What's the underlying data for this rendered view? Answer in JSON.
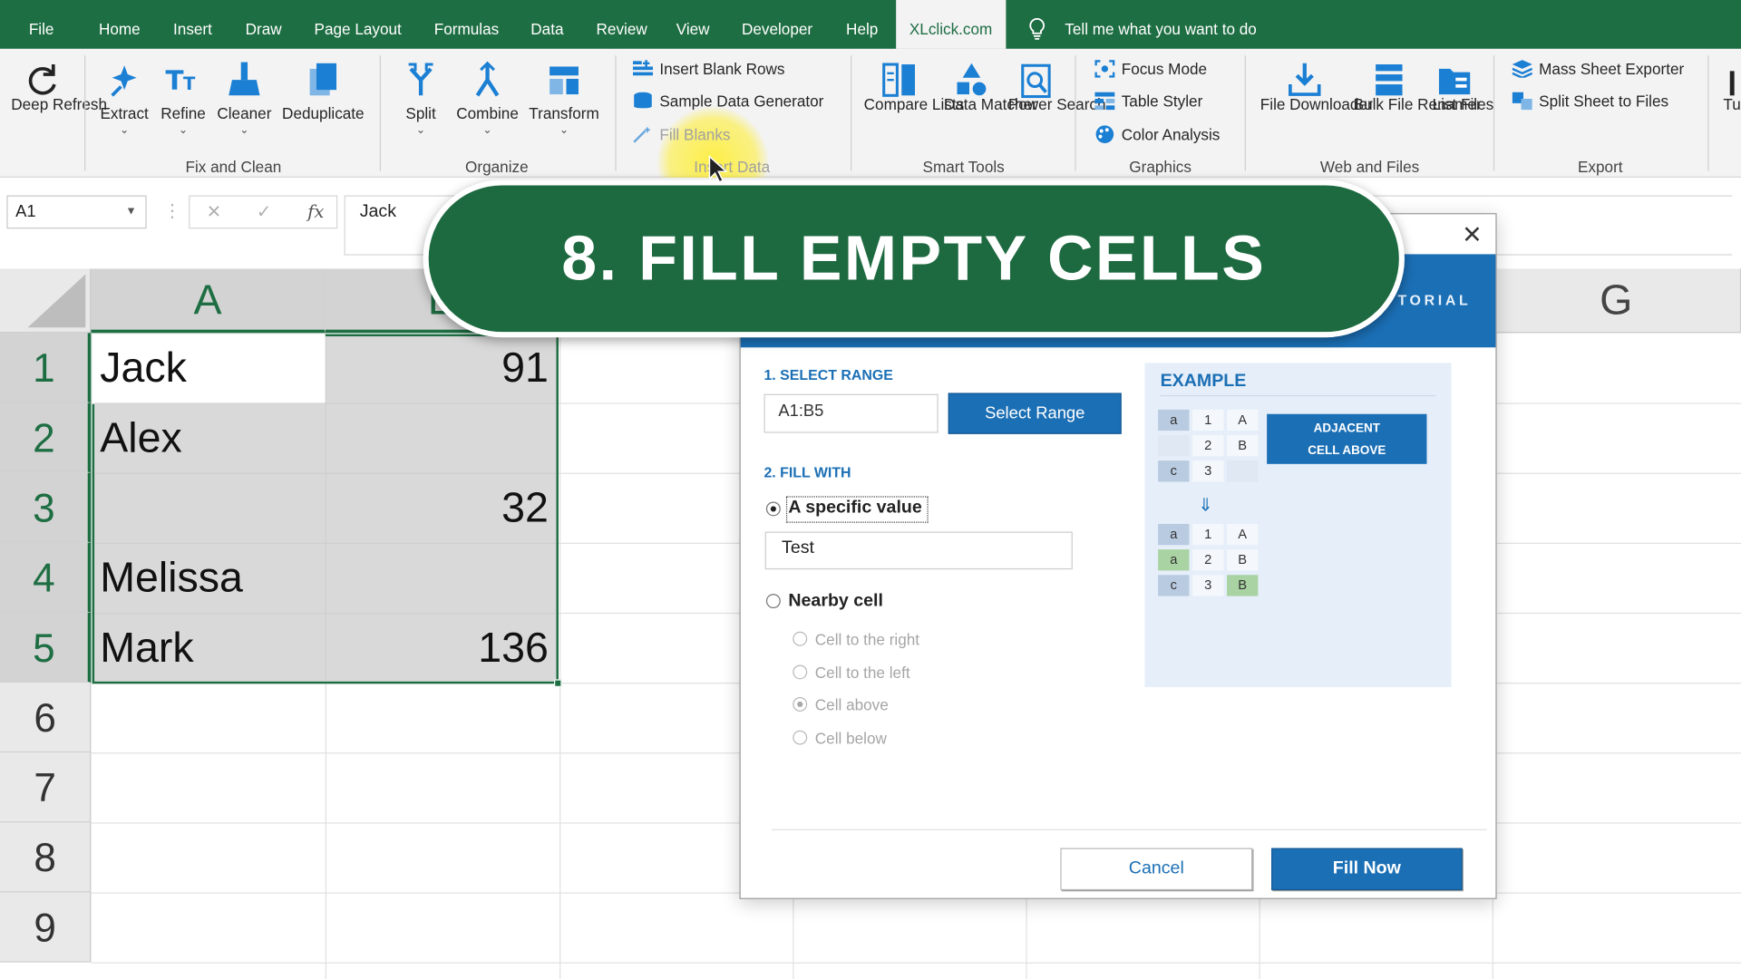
{
  "tabs": [
    "File",
    "Home",
    "Insert",
    "Draw",
    "Page Layout",
    "Formulas",
    "Data",
    "Review",
    "View",
    "Developer",
    "Help",
    "XLclick.com"
  ],
  "active_tab": "XLclick.com",
  "tell_me": "Tell me what you want to do",
  "ribbon": {
    "deep_refresh": "Deep Refresh",
    "fix_and_clean": {
      "label": "Fix and Clean",
      "extract": "Extract",
      "refine": "Refine",
      "cleaner": "Cleaner",
      "deduplicate": "Deduplicate"
    },
    "organize": {
      "label": "Organize",
      "split": "Split",
      "combine": "Combine",
      "transform": "Transform"
    },
    "insert_data": {
      "label": "Insert Data",
      "insert_blank_rows": "Insert Blank Rows",
      "sample_data_generator": "Sample Data Generator",
      "fill_blanks": "Fill Blanks"
    },
    "smart_tools": {
      "label": "Smart Tools",
      "compare_lists": "Compare Lists",
      "data_matcher": "Data Matcher",
      "power_search": "Power Search"
    },
    "graphics": {
      "label": "Graphics",
      "focus_mode": "Focus Mode",
      "table_styler": "Table Styler",
      "color_analysis": "Color Analysis"
    },
    "web_and_files": {
      "label": "Web and Files",
      "file_downloader": "File Downloader",
      "bulk_file_renamer": "Bulk File Renamer",
      "list_files": "List Files"
    },
    "export": {
      "label": "Export",
      "mass_sheet_exporter": "Mass Sheet Exporter",
      "split_sheet_to_files": "Split Sheet to Files"
    },
    "overflow": "Tu"
  },
  "formula_bar": {
    "name_box": "A1",
    "cancel_glyph": "✕",
    "enter_glyph": "✓",
    "fx_glyph": "fx",
    "value": "Jack"
  },
  "sheet": {
    "columns": [
      "A",
      "B",
      "G"
    ],
    "rows": [
      "1",
      "2",
      "3",
      "4",
      "5",
      "6",
      "7",
      "8",
      "9"
    ],
    "col_a": [
      "Jack",
      "Alex",
      "",
      "Melissa",
      "Mark"
    ],
    "col_b": [
      "91",
      "",
      "32",
      "",
      "136"
    ]
  },
  "banner": "8. FILL EMPTY CELLS",
  "dialog": {
    "close": "✕",
    "banner_tag": "TORIAL",
    "select_range_title": "1. SELECT RANGE",
    "range_value": "A1:B5",
    "select_range_button": "Select Range",
    "fill_with_title": "2. FILL WITH",
    "specific_value_label": "A specific value",
    "specific_value_input": "Test",
    "nearby_cell_label": "Nearby cell",
    "options": [
      "Cell to the right",
      "Cell to the left",
      "Cell above",
      "Cell below"
    ],
    "selected_option": "Cell above",
    "example": {
      "title": "EXAMPLE",
      "badge_line1": "ADJACENT",
      "badge_line2": "CELL ABOVE",
      "before": [
        [
          "a",
          "1",
          "A"
        ],
        [
          "",
          "2",
          "B"
        ],
        [
          "c",
          "3",
          ""
        ]
      ],
      "after": [
        [
          "a",
          "1",
          "A"
        ],
        [
          "a",
          "2",
          "B"
        ],
        [
          "c",
          "3",
          "B"
        ]
      ],
      "arrow": "⇓"
    },
    "cancel_button": "Cancel",
    "fill_button": "Fill Now"
  },
  "colors": {
    "excel_green": "#1e6e43",
    "accent_blue": "#1b6fb5",
    "cursor_highlight": "#ffee28"
  }
}
